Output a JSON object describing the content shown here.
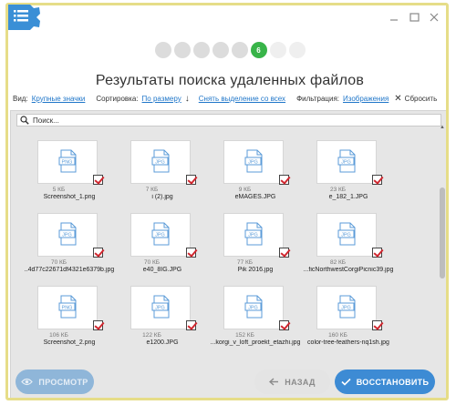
{
  "window": {
    "colors": {
      "frame": "#e6dd88",
      "accent": "#3d8bd4",
      "step_active": "#38b449"
    },
    "controls": [
      "minimize-icon",
      "maximize-icon",
      "close-icon"
    ]
  },
  "wizard": {
    "steps_total": 8,
    "current_step": 6,
    "current_label": "6"
  },
  "title": "Результаты поиска удаленных файлов",
  "toolbar": {
    "view_label": "Вид:",
    "view_value": "Крупные значки",
    "sort_label": "Сортировка:",
    "sort_value": "По размеру",
    "deselect_label": "Снять выделение со всех",
    "filter_label": "Фильтрация:",
    "filter_value": "Изображения",
    "reset_label": "Сбросить"
  },
  "search": {
    "placeholder": "Поиск..."
  },
  "files": [
    {
      "size": "5 КБ",
      "name": "Screenshot_1.png",
      "type": "PNG"
    },
    {
      "size": "7 КБ",
      "name": "i (2).jpg",
      "type": "JPG"
    },
    {
      "size": "9 КБ",
      "name": "eMAGES.JPG",
      "type": "JPG"
    },
    {
      "size": "23 КБ",
      "name": "e_182_1.JPG",
      "type": "JPG"
    },
    {
      "size": "70 КБ",
      "name": "..4d77c22671df4321e6379b.jpg",
      "type": "JPG"
    },
    {
      "size": "70 КБ",
      "name": "e40_8IG.JPG",
      "type": "JPG"
    },
    {
      "size": "77 КБ",
      "name": "Pik 2016.jpg",
      "type": "JPG"
    },
    {
      "size": "82 КБ",
      "name": "...ficNorthwestCorgiPicnic39.jpg",
      "type": "JPG"
    },
    {
      "size": "106 КБ",
      "name": "Screenshot_2.png",
      "type": "PNG"
    },
    {
      "size": "122 КБ",
      "name": "e1200.JPG",
      "type": "JPG"
    },
    {
      "size": "152 КБ",
      "name": "...korgi_v_loft_proekt_etazhi.jpg",
      "type": "JPG"
    },
    {
      "size": "160 КБ",
      "name": "color-tree-feathers-nq1sh.jpg",
      "type": "JPG"
    }
  ],
  "buttons": {
    "preview": "ПРОСМОТР",
    "back": "НАЗАД",
    "restore": "ВОССТАНОВИТЬ"
  }
}
